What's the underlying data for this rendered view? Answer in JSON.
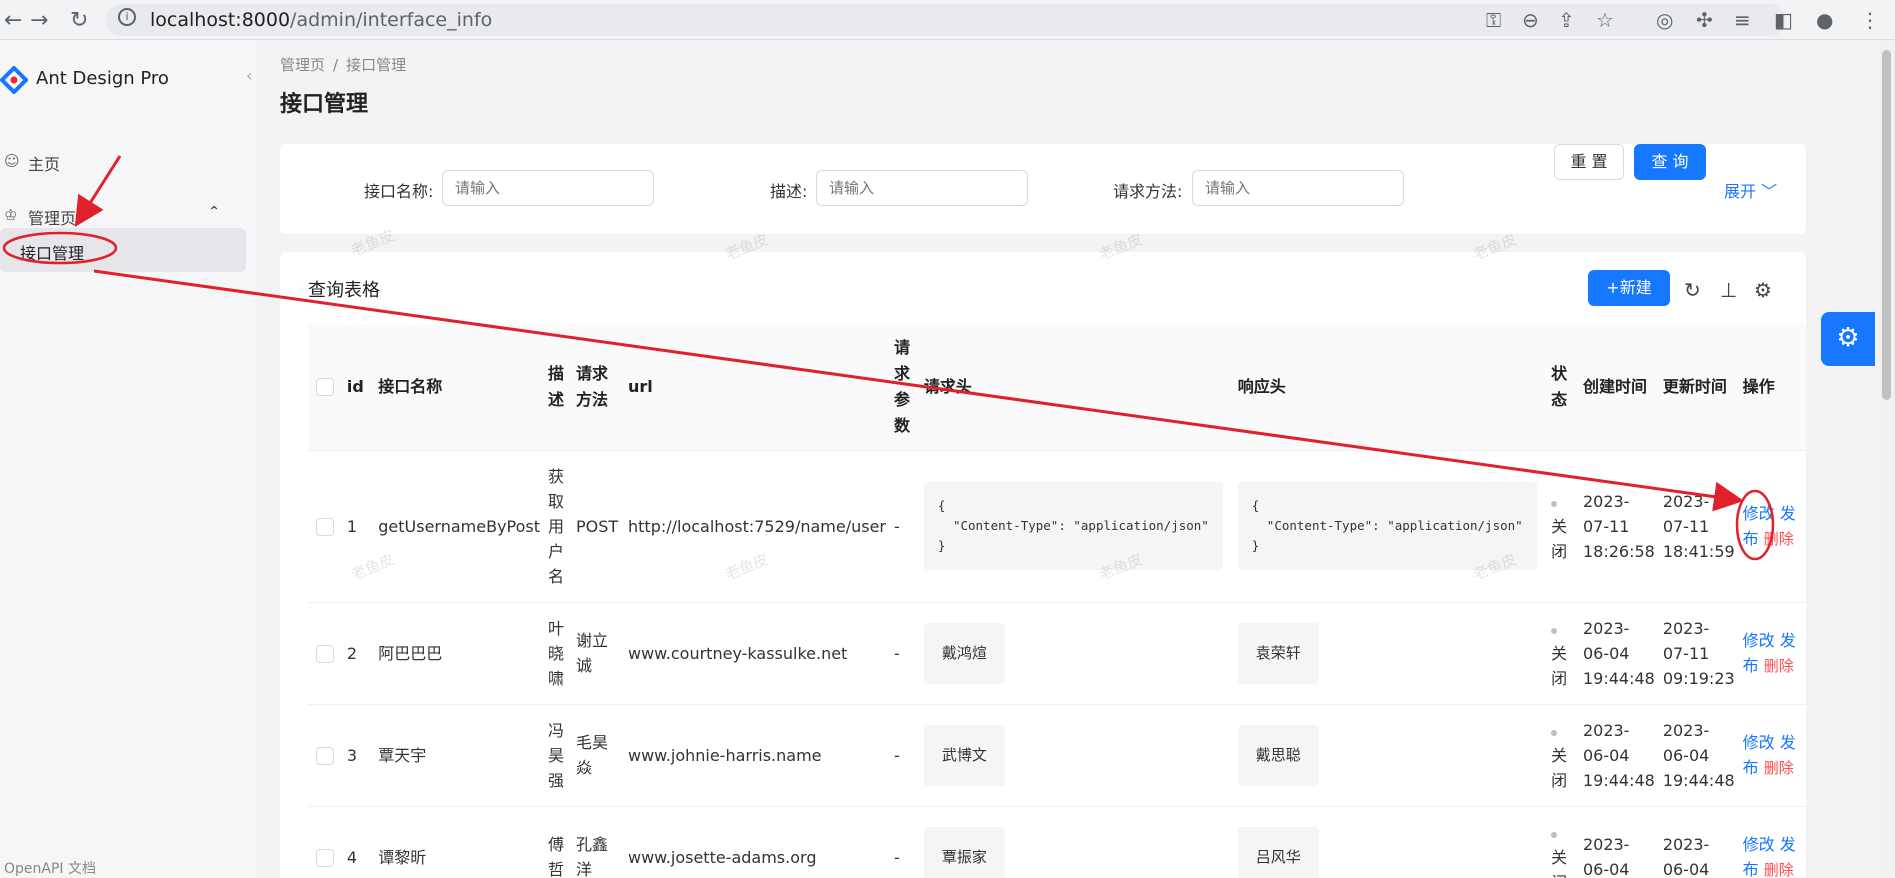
{
  "browser": {
    "url_host": "localhost:8000",
    "url_path": "/admin/interface_info"
  },
  "sidebar": {
    "brand": "Ant Design Pro",
    "items": [
      {
        "label": "主页",
        "icon": "smile-icon"
      },
      {
        "label": "管理页",
        "icon": "crown-icon"
      }
    ],
    "sub_item": "接口管理",
    "footer": "OpenAPI 文档"
  },
  "breadcrumb": [
    "管理页",
    "接口管理"
  ],
  "page_title": "接口管理",
  "search": {
    "fields": [
      {
        "label": "接口名称:",
        "placeholder": "请输入"
      },
      {
        "label": "描述:",
        "placeholder": "请输入"
      },
      {
        "label": "请求方法:",
        "placeholder": "请输入"
      }
    ],
    "reset_label": "重 置",
    "query_label": "查 询",
    "expand_label": "展开"
  },
  "table": {
    "title": "查询表格",
    "new_label": "新建",
    "columns": [
      "id",
      "接口名称",
      "描述",
      "请求方法",
      "url",
      "请求参数",
      "请求头",
      "响应头",
      "状态",
      "创建时间",
      "更新时间",
      "操作"
    ],
    "rows": [
      {
        "id": "1",
        "name": "getUsernameByPost",
        "desc": "获取用户名",
        "method": "POST",
        "url": "http://localhost:7529/name/user",
        "params": "-",
        "req_header": "{\n  \"Content-Type\": \"application/json\"\n}",
        "resp_header": "{\n  \"Content-Type\": \"application/json\"\n}",
        "status": "关闭",
        "created": "2023-07-11 18:26:58",
        "updated": "2023-07-11 18:41:59"
      },
      {
        "id": "2",
        "name": "阿巴巴巴",
        "desc": "叶晓啸",
        "method": "谢立诚",
        "url": "www.courtney-kassulke.net",
        "params": "-",
        "req_header": "戴鸿煊",
        "resp_header": "袁荣轩",
        "status": "关闭",
        "created": "2023-06-04 19:44:48",
        "updated": "2023-07-11 09:19:23"
      },
      {
        "id": "3",
        "name": "覃天宇",
        "desc": "冯昊强",
        "method": "毛昊焱",
        "url": "www.johnie-harris.name",
        "params": "-",
        "req_header": "武博文",
        "resp_header": "戴思聪",
        "status": "关闭",
        "created": "2023-06-04 19:44:48",
        "updated": "2023-06-04 19:44:48"
      },
      {
        "id": "4",
        "name": "谭黎昕",
        "desc": "傅哲",
        "method": "孔鑫洋",
        "url": "www.josette-adams.org",
        "params": "-",
        "req_header": "覃振家",
        "resp_header": "吕风华",
        "status": "关闭",
        "created": "2023-06-04",
        "updated": "2023-06-04"
      }
    ],
    "op_edit": "修改",
    "op_publish": "发布",
    "op_delete": "删除"
  },
  "watermark": "老鱼皮",
  "colors": {
    "primary": "#1677ff",
    "danger": "#ff4d4f",
    "annotation": "#e0202a"
  }
}
